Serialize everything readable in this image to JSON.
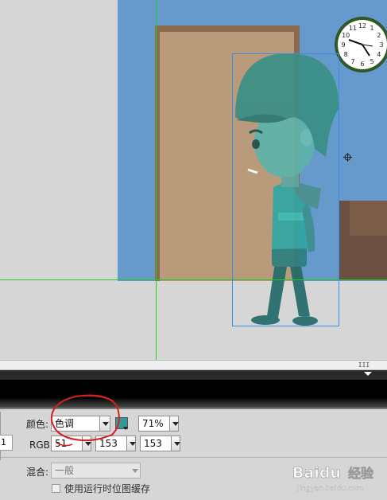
{
  "color_effect": {
    "label": "颜色:",
    "style_value": "色调",
    "tint_color": "#339999",
    "tint_percent": "71%"
  },
  "rgb": {
    "label": "RGB:",
    "r": "51",
    "g": "153",
    "b": "153"
  },
  "left_field_value": "1",
  "blend": {
    "label": "混合:",
    "value": "一般"
  },
  "cache_bitmap": {
    "label": "使用运行时位图缓存",
    "checked": false
  },
  "scrollbar_grip": "III",
  "watermark": {
    "brand": "Baidu",
    "suffix": "经验",
    "url": "jingyan.baidu.com"
  },
  "clock": {
    "numerals": [
      "12",
      "1",
      "2",
      "3",
      "4",
      "5",
      "6",
      "7",
      "8",
      "9",
      "10",
      "11"
    ]
  },
  "colors": {
    "stage_bg": "#d6d6d6",
    "scene_bg": "#6699cc",
    "guide": "#22cc22",
    "selection": "#3a8ee6",
    "annotation_red": "#d42020"
  }
}
